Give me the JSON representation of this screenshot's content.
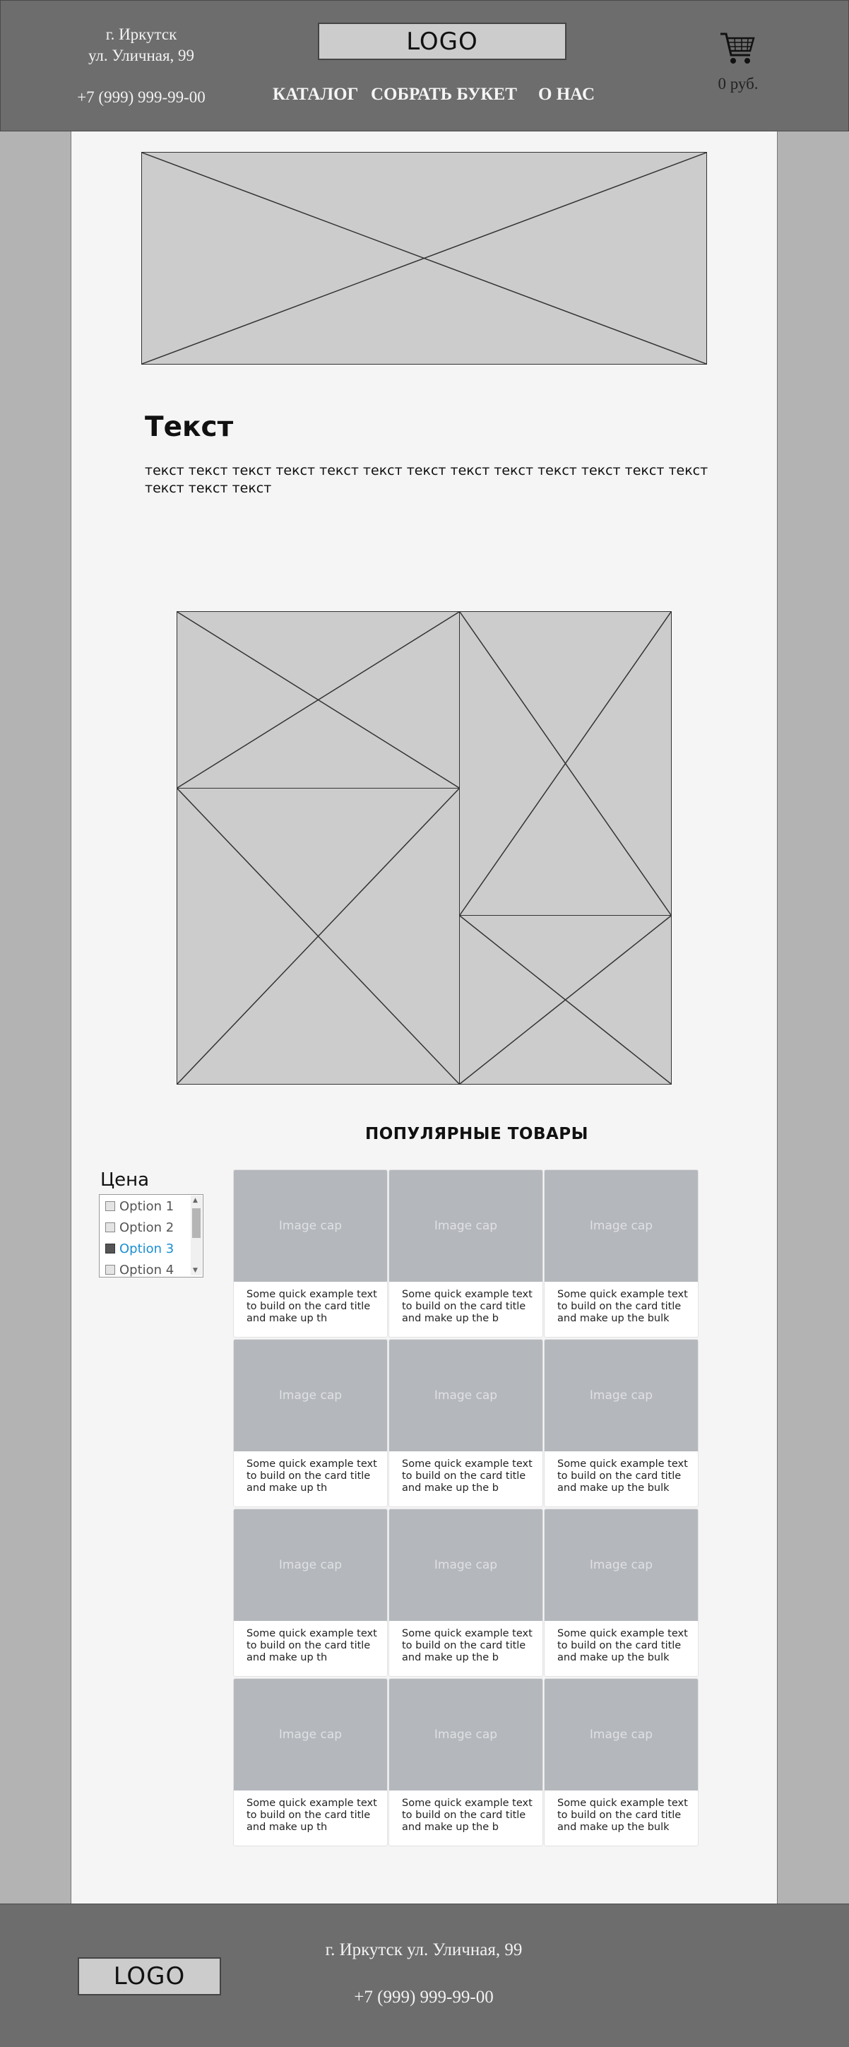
{
  "header": {
    "address_city": "г. Иркутск",
    "address_street": "ул. Уличная, 99",
    "phone": "+7 (999) 999-99-00",
    "logo": "LOGO",
    "nav": [
      "КАТАЛОГ",
      "СОБРАТЬ БУКЕТ",
      "О НАС"
    ],
    "cart_icon": "shopping-cart-icon",
    "cart_total": "0 руб."
  },
  "intro": {
    "title": "Текст",
    "text": "текст текст текст текст текст текст текст текст текст текст текст текст текст текст текст текст"
  },
  "popular": {
    "title": "ПОПУЛЯРНЫЕ ТОВАРЫ",
    "filter_label": "Цена",
    "filter_options": [
      {
        "label": "Option 1",
        "checked": false
      },
      {
        "label": "Option 2",
        "checked": false
      },
      {
        "label": "Option 3",
        "checked": true
      },
      {
        "label": "Option 4",
        "checked": false
      }
    ],
    "card_cap": "Image cap",
    "card_texts": [
      "Some quick example text to build on the card title and make up th",
      "Some quick example text to build on the card title and make up the b",
      "Some quick example text to build on the card title and make up the bulk"
    ]
  },
  "footer": {
    "logo": "LOGO",
    "address": "г. Иркутск ул. Уличная, 99",
    "phone": "+7 (999) 999-99-00"
  }
}
